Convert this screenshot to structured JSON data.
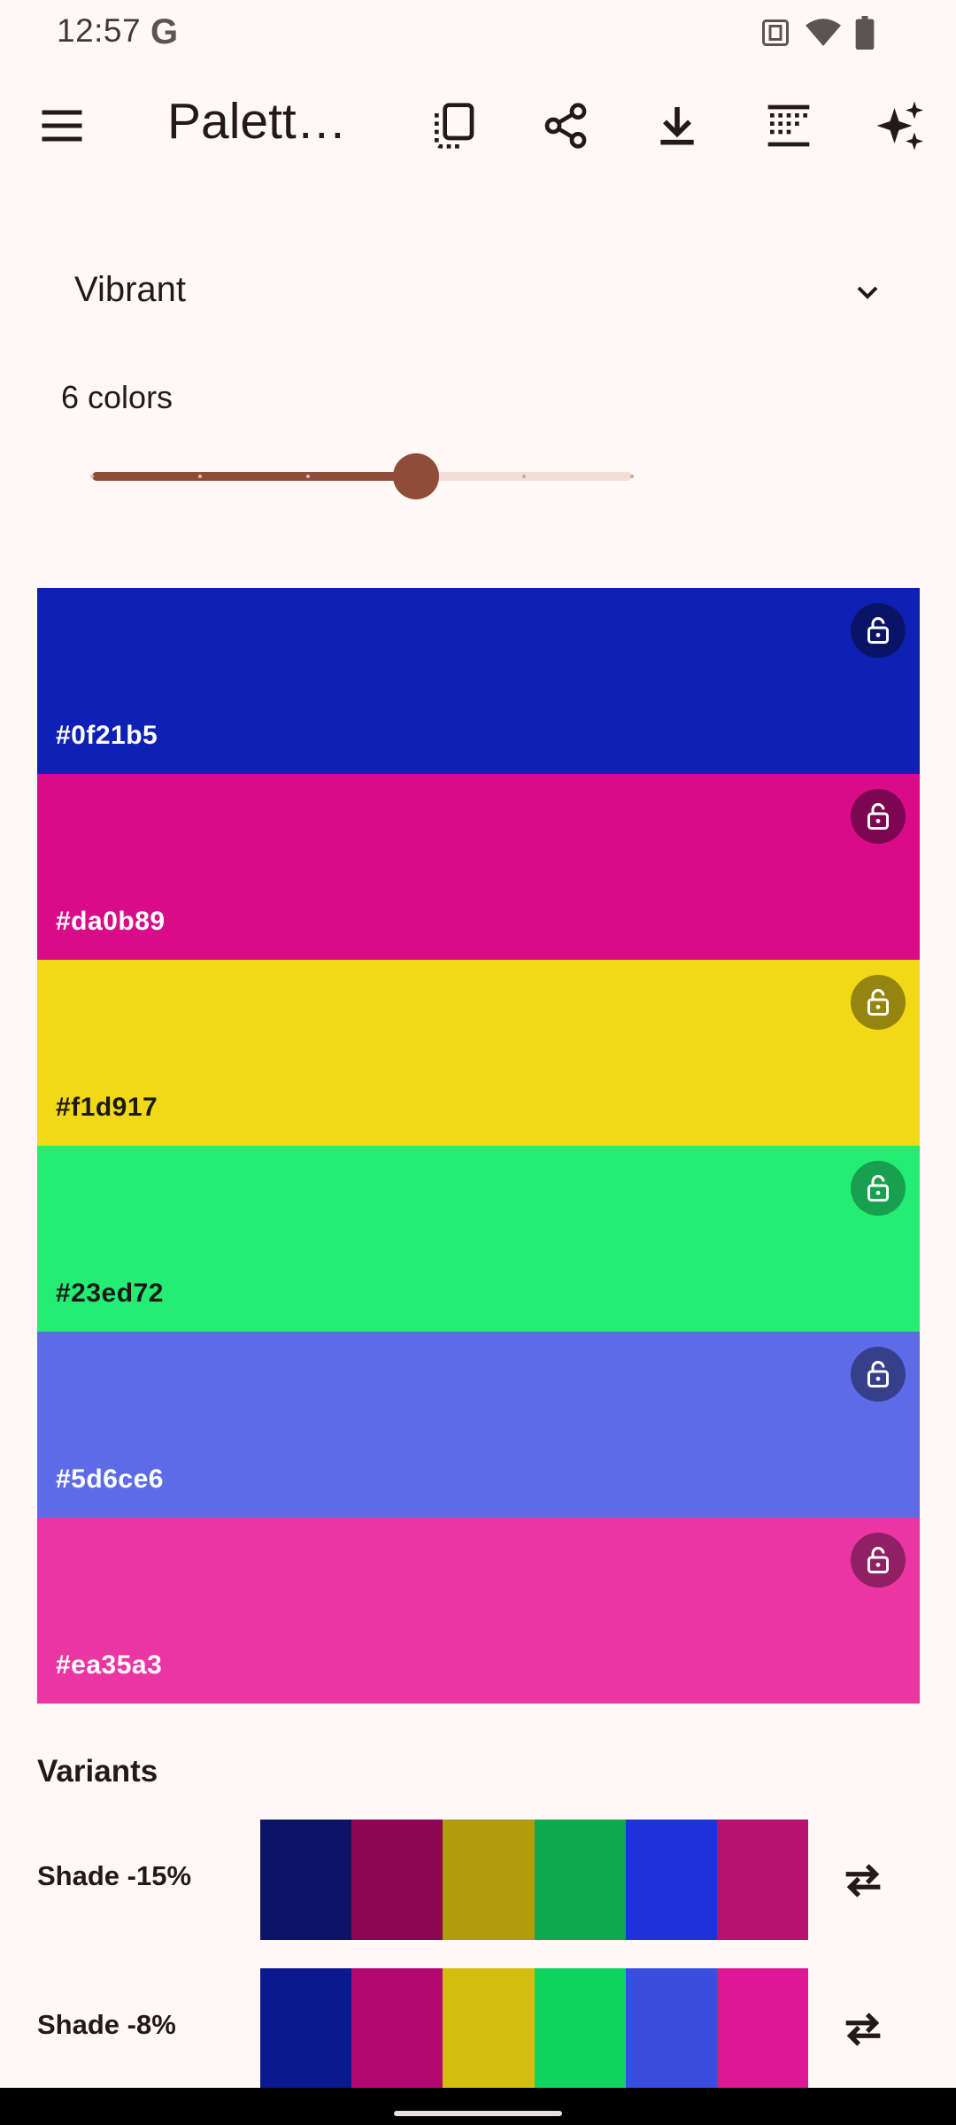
{
  "status_bar": {
    "time": "12:57",
    "g_logo": "G",
    "icons": [
      "nfc-icon",
      "wifi-icon",
      "battery-icon"
    ]
  },
  "app_bar": {
    "title": "Palett…",
    "actions": [
      "copy-icon",
      "share-icon",
      "download-icon",
      "gradient-icon",
      "sparkle-icon"
    ]
  },
  "dropdown": {
    "selected": "Vibrant"
  },
  "color_count": {
    "label": "6 colors",
    "value": 6,
    "min": 3,
    "max": 8
  },
  "swatches": [
    {
      "hex": "#0f21b5",
      "text_color": "#ffffff",
      "lock_bg": "#0a1466"
    },
    {
      "hex": "#da0b89",
      "text_color": "#ffffff",
      "lock_bg": "#7c0650"
    },
    {
      "hex": "#f1d917",
      "text_color": "#1a1a1a",
      "lock_bg": "#948510"
    },
    {
      "hex": "#23ed72",
      "text_color": "#1a1a1a",
      "lock_bg": "#17a04d"
    },
    {
      "hex": "#5d6ce6",
      "text_color": "#ffffff",
      "lock_bg": "#36408a"
    },
    {
      "hex": "#ea35a3",
      "text_color": "#ffffff",
      "lock_bg": "#8e2063"
    }
  ],
  "variants": {
    "title": "Variants",
    "rows": [
      {
        "label": "Shade -15%",
        "colors": [
          "#0c1468",
          "#8e0553",
          "#b09c0d",
          "#0ea94f",
          "#1f31d8",
          "#b8116f"
        ]
      },
      {
        "label": "Shade -8%",
        "colors": [
          "#0b1990",
          "#b30870",
          "#d3bd10",
          "#0fd45e",
          "#3a4ddf",
          "#de1894"
        ]
      }
    ]
  },
  "colors": {
    "background": "#fff8f6",
    "primary": "#8f4c38",
    "primary_container": "#f3ddd7"
  }
}
